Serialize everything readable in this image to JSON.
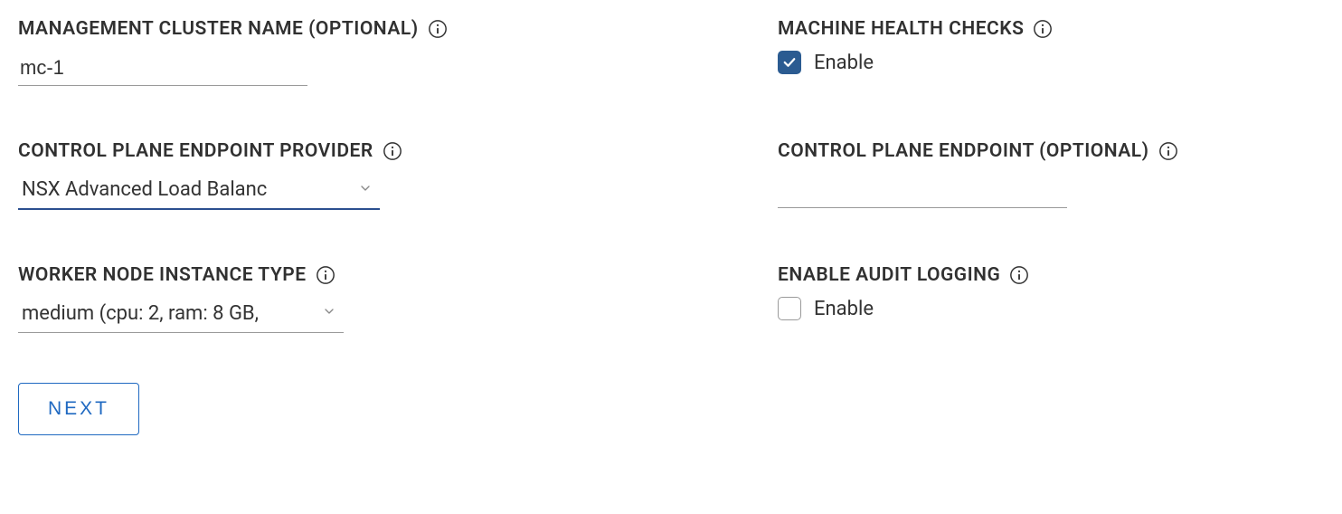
{
  "fields": {
    "managementClusterName": {
      "label": "MANAGEMENT CLUSTER NAME (OPTIONAL)",
      "value": "mc-1"
    },
    "machineHealthChecks": {
      "label": "MACHINE HEALTH CHECKS",
      "checkboxLabel": "Enable",
      "checked": true
    },
    "controlPlaneEndpointProvider": {
      "label": "CONTROL PLANE ENDPOINT PROVIDER",
      "value": "NSX Advanced Load Balanc"
    },
    "controlPlaneEndpoint": {
      "label": "CONTROL PLANE ENDPOINT (OPTIONAL)",
      "value": ""
    },
    "workerNodeInstanceType": {
      "label": "WORKER NODE INSTANCE TYPE",
      "value": "medium (cpu: 2, ram: 8 GB,"
    },
    "enableAuditLogging": {
      "label": "ENABLE AUDIT LOGGING",
      "checkboxLabel": "Enable",
      "checked": false
    }
  },
  "buttons": {
    "next": "NEXT"
  }
}
